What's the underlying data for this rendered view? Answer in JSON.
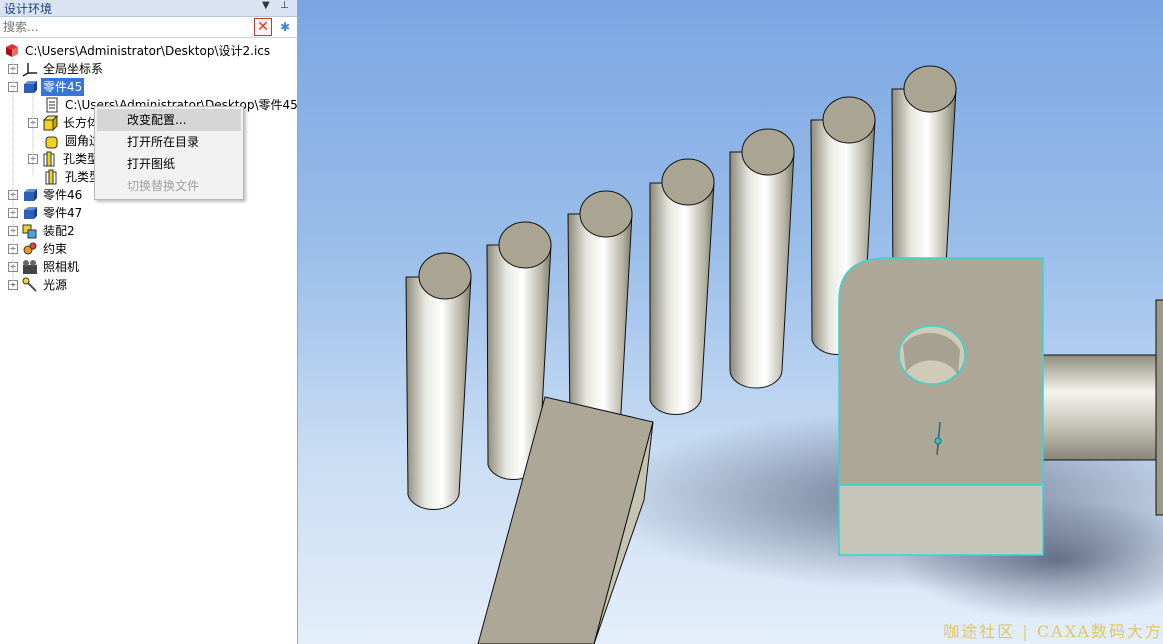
{
  "panel": {
    "title": "设计环境",
    "search_placeholder": "搜索...",
    "tree": {
      "root": "C:\\Users\\Administrator\\Desktop\\设计2.ics",
      "items": [
        {
          "label": "全局坐标系"
        },
        {
          "label": "零件45"
        },
        {
          "label": "C:\\Users\\Administrator\\Desktop\\零件45"
        },
        {
          "label": "长方体"
        },
        {
          "label": "圆角过"
        },
        {
          "label": "孔类型"
        },
        {
          "label": "孔类型"
        },
        {
          "label": "零件46"
        },
        {
          "label": "零件47"
        },
        {
          "label": "装配2"
        },
        {
          "label": "约束"
        },
        {
          "label": "照相机"
        },
        {
          "label": "光源"
        }
      ]
    }
  },
  "context_menu": {
    "items": [
      {
        "label": "改变配置..."
      },
      {
        "label": "打开所在目录"
      },
      {
        "label": "打开图纸"
      },
      {
        "label": "切换替换文件"
      }
    ]
  },
  "viewport": {
    "watermark": "咖途社区 | CAXA数码大方"
  },
  "colors": {
    "selection": "#3875d7",
    "edge_highlight": "#33d6d6"
  }
}
